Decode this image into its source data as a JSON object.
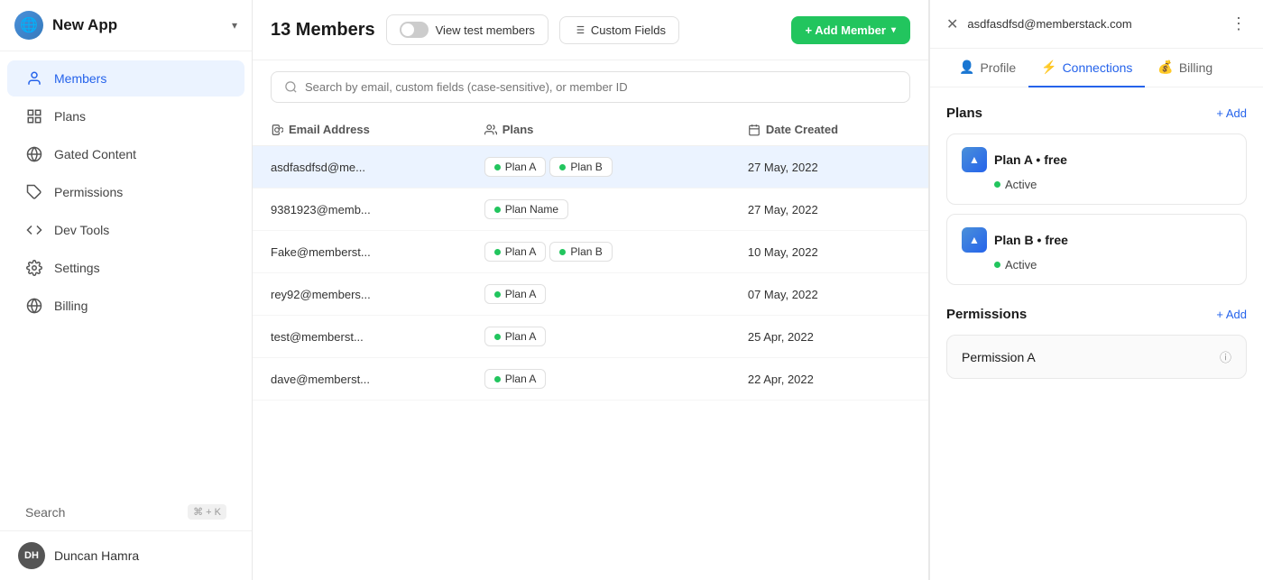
{
  "sidebar": {
    "app_name": "New App",
    "nav_items": [
      {
        "id": "members",
        "label": "Members",
        "icon": "👤",
        "active": true
      },
      {
        "id": "plans",
        "label": "Plans",
        "icon": "📋",
        "active": false
      },
      {
        "id": "gated-content",
        "label": "Gated Content",
        "icon": "🌐",
        "active": false
      },
      {
        "id": "permissions",
        "label": "Permissions",
        "icon": "🏷️",
        "active": false
      },
      {
        "id": "dev-tools",
        "label": "Dev Tools",
        "icon": "⟨⟩",
        "active": false
      },
      {
        "id": "settings",
        "label": "Settings",
        "icon": "⚙️",
        "active": false
      },
      {
        "id": "billing",
        "label": "Billing",
        "icon": "🌐",
        "active": false
      }
    ],
    "search_label": "Search",
    "search_shortcut": "⌘ + K",
    "user": {
      "name": "Duncan Hamra",
      "initials": "DH"
    }
  },
  "members": {
    "count_label": "13 Members",
    "view_test_label": "View test members",
    "custom_fields_label": "Custom Fields",
    "add_member_label": "+ Add Member",
    "search_placeholder": "Search by email, custom fields (case-sensitive), or member ID",
    "columns": {
      "email": "Email Address",
      "plans": "Plans",
      "date": "Date Created"
    },
    "rows": [
      {
        "email": "asdfasdfsd@me...",
        "plans": [
          "Plan A",
          "Plan B"
        ],
        "date": "27 May, 2022",
        "selected": true
      },
      {
        "email": "9381923@memb...",
        "plans": [
          "Plan Name"
        ],
        "date": "27 May, 2022",
        "selected": false
      },
      {
        "email": "Fake@memberst...",
        "plans": [
          "Plan A",
          "Plan B"
        ],
        "date": "10 May, 2022",
        "selected": false
      },
      {
        "email": "rey92@members...",
        "plans": [
          "Plan A"
        ],
        "date": "07 May, 2022",
        "selected": false
      },
      {
        "email": "test@memberst...",
        "plans": [
          "Plan A"
        ],
        "date": "25 Apr, 2022",
        "selected": false
      },
      {
        "email": "dave@memberst...",
        "plans": [
          "Plan A"
        ],
        "date": "22 Apr, 2022",
        "selected": false
      }
    ]
  },
  "detail": {
    "email": "asdfasdfsd@memberstack.com",
    "tabs": [
      {
        "id": "profile",
        "label": "Profile",
        "icon": "👤",
        "active": false
      },
      {
        "id": "connections",
        "label": "Connections",
        "icon": "⚡",
        "active": true
      },
      {
        "id": "billing",
        "label": "Billing",
        "icon": "💰",
        "active": false
      }
    ],
    "plans_section": {
      "title": "Plans",
      "add_label": "+ Add",
      "items": [
        {
          "name": "Plan A",
          "type": "free",
          "status": "Active"
        },
        {
          "name": "Plan B",
          "type": "free",
          "status": "Active"
        }
      ]
    },
    "permissions_section": {
      "title": "Permissions",
      "add_label": "+ Add",
      "items": [
        {
          "name": "Permission A"
        }
      ]
    }
  },
  "colors": {
    "active_nav_bg": "#EBF3FF",
    "active_nav_text": "#2563EB",
    "add_btn_bg": "#22c55e",
    "active_tab": "#2563EB",
    "plan_dot": "#22c55e",
    "status_dot": "#22c55e"
  }
}
